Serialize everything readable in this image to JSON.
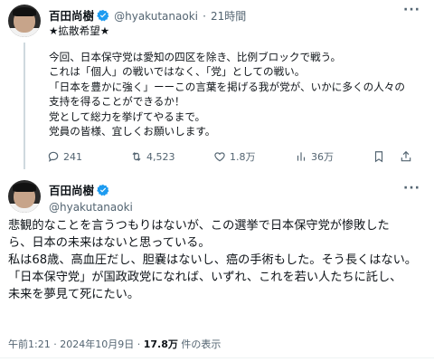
{
  "tweet1": {
    "author_name": "百田尚樹",
    "handle": "@hyakutanaoki",
    "separator": "·",
    "time": "21時間",
    "lines": [
      "★拡散希望★",
      "",
      "今回、日本保守党は愛知の四区を除き、比例ブロックで戦う。",
      "これは「個人」の戦いではなく、「党」としての戦い。",
      "「日本を豊かに強く」ーーこの言葉を掲げる我が党が、いかに多くの人々の",
      "支持を得ることができるか！",
      "党として総力を挙げてやるまで。",
      "党員の皆様、宜しくお願いします。"
    ],
    "actions": {
      "reply_count": "241",
      "retweet_count": "4,523",
      "like_count": "1.8万",
      "view_count": "36万"
    }
  },
  "tweet2": {
    "author_name": "百田尚樹",
    "handle": "@hyakutanaoki",
    "lines": [
      "悲観的なことを言うつもりはないが、この選挙で日本保守党が惨敗した",
      "ら、日本の未来はないと思っている。",
      "私は68歳、高血圧だし、胆嚢はないし、癌の手術もした。そう長くはない。",
      "「日本保守党」が国政政党になれば、いずれ、これを若い人たちに託し、",
      "未来を夢見て死にたい。"
    ],
    "meta": {
      "time": "午前1:21",
      "separator": "·",
      "date": "2024年10月9日",
      "separator2": "·",
      "views": "17.8万",
      "views_suffix": " 件の表示"
    }
  },
  "colors": {
    "verified": "#1d9bf0",
    "secondary_text": "#536471",
    "primary_text": "#0f1419"
  }
}
